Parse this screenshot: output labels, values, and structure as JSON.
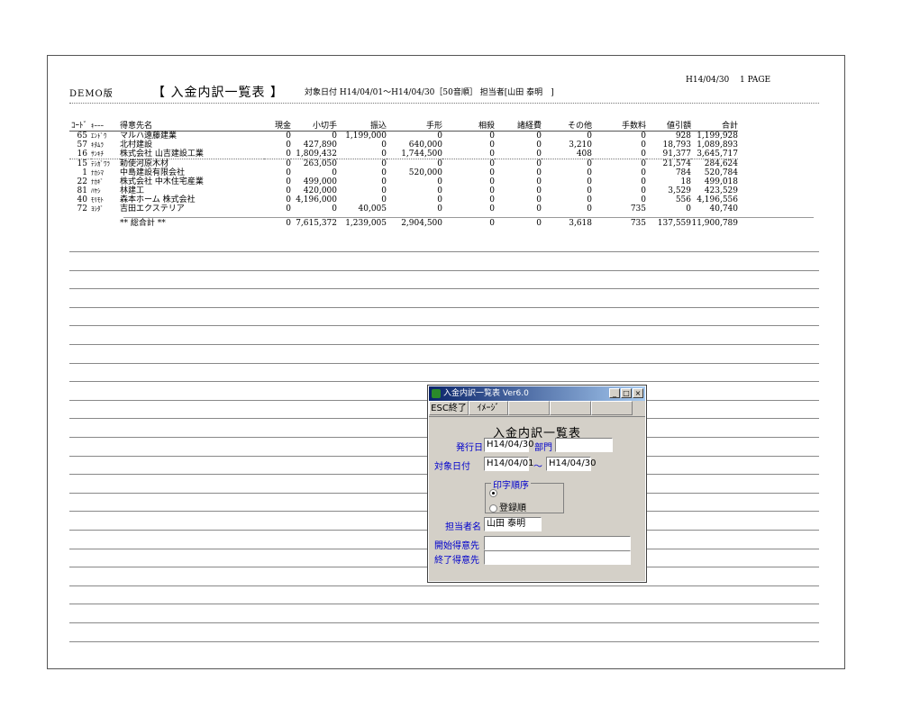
{
  "report": {
    "demo": "DEMO版",
    "title": "【 入金内訳一覧表 】",
    "condition": "対象日付 H14/04/01～H14/04/30［50音順］ 担当者[山田 泰明　]",
    "print_date": "H14/04/30",
    "page": "1 PAGE",
    "columns": [
      "ｺｰﾄﾞ",
      "ｷｰｰｰ",
      "得意先名",
      "現金",
      "小切手",
      "振込",
      "手形",
      "相殺",
      "諸経費",
      "その他",
      "手数料",
      "値引額",
      "合計"
    ],
    "rows": [
      {
        "code": "65",
        "kana": "ｴﾝﾄﾞｳ",
        "name": "マルハ遠藤建業",
        "cash": "0",
        "check": "0",
        "transfer": "1,199,000",
        "bill": "0",
        "offset": "0",
        "expense": "0",
        "other": "0",
        "fee": "0",
        "discount": "928",
        "total": "1,199,928"
      },
      {
        "code": "57",
        "kana": "ｷﾀﾑﾗ",
        "name": "北村建設",
        "cash": "0",
        "check": "427,890",
        "transfer": "0",
        "bill": "640,000",
        "offset": "0",
        "expense": "0",
        "other": "3,210",
        "fee": "0",
        "discount": "18,793",
        "total": "1,089,893"
      },
      {
        "code": "16",
        "kana": "ｻﾝｷﾁ",
        "name": "株式会社 山吉建設工業",
        "cash": "0",
        "check": "1,809,432",
        "transfer": "0",
        "bill": "1,744,500",
        "offset": "0",
        "expense": "0",
        "other": "408",
        "fee": "0",
        "discount": "91,377",
        "total": "3,645,717"
      },
      {
        "code": "15",
        "kana": "ﾃｼｶﾞﾜﾗ",
        "name": "勅使河原木材",
        "cash": "0",
        "check": "263,050",
        "transfer": "0",
        "bill": "0",
        "offset": "0",
        "expense": "0",
        "other": "0",
        "fee": "0",
        "discount": "21,574",
        "total": "284,624"
      },
      {
        "code": "1",
        "kana": "ﾅｶｼﾏ",
        "name": "中島建設有限会社",
        "cash": "0",
        "check": "0",
        "transfer": "0",
        "bill": "520,000",
        "offset": "0",
        "expense": "0",
        "other": "0",
        "fee": "0",
        "discount": "784",
        "total": "520,784"
      },
      {
        "code": "22",
        "kana": "ﾅｶｷﾞ",
        "name": "株式会社 中木住宅産業",
        "cash": "0",
        "check": "499,000",
        "transfer": "0",
        "bill": "0",
        "offset": "0",
        "expense": "0",
        "other": "0",
        "fee": "0",
        "discount": "18",
        "total": "499,018"
      },
      {
        "code": "81",
        "kana": "ﾊﾔｼ",
        "name": "林建工",
        "cash": "0",
        "check": "420,000",
        "transfer": "0",
        "bill": "0",
        "offset": "0",
        "expense": "0",
        "other": "0",
        "fee": "0",
        "discount": "3,529",
        "total": "423,529"
      },
      {
        "code": "40",
        "kana": "ﾓﾘﾓﾄ",
        "name": "森本ホーム 株式会社",
        "cash": "0",
        "check": "4,196,000",
        "transfer": "0",
        "bill": "0",
        "offset": "0",
        "expense": "0",
        "other": "0",
        "fee": "0",
        "discount": "556",
        "total": "4,196,556"
      },
      {
        "code": "72",
        "kana": "ﾖｼﾀﾞ",
        "name": "吉田エクステリア",
        "cash": "0",
        "check": "0",
        "transfer": "40,005",
        "bill": "0",
        "offset": "0",
        "expense": "0",
        "other": "0",
        "fee": "735",
        "discount": "0",
        "total": "40,740"
      }
    ],
    "grand_total": {
      "label": "** 総合計 **",
      "cash": "0",
      "check": "7,615,372",
      "transfer": "1,239,005",
      "bill": "2,904,500",
      "offset": "0",
      "expense": "0",
      "other": "3,618",
      "fee": "735",
      "discount": "137,559",
      "total": "11,900,789"
    }
  },
  "dialog": {
    "caption": "入金内訳一覧表 Ver6.0",
    "minimize": "_",
    "maximize": "□",
    "close": "×",
    "esc_button": "ESC終了",
    "image_button": "ｲﾒｰｼﾞ",
    "heading": "入金内訳一覧表",
    "issue_date_label": "発行日",
    "issue_date_value": "H14/04/30",
    "department_label": "部門",
    "department_value": "",
    "target_date_label": "対象日付",
    "target_from": "H14/04/01",
    "tilde": "～",
    "target_to": "H14/04/30",
    "print_order_label": "印字順序",
    "order_option_1": "",
    "order_option_2": "登録順",
    "person_label": "担当者名",
    "person_value": "山田 泰明",
    "start_customer_label": "開始得意先",
    "start_customer_value": "",
    "end_customer_label": "終了得意先",
    "end_customer_value": ""
  }
}
